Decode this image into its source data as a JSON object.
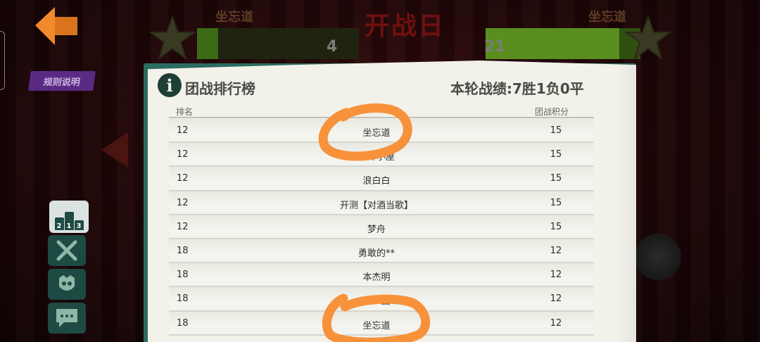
{
  "header": {
    "title": "开战日",
    "left_team": "坐忘道",
    "right_team": "坐忘道",
    "left_score": "4",
    "right_score": "21"
  },
  "rules_button": {
    "label": "规则说明"
  },
  "side_menu": {
    "icons": [
      "leaderboard-icon",
      "crossed-swords-icon",
      "guild-emblem-icon",
      "chat-icon"
    ],
    "podium": [
      "2",
      "1",
      "3"
    ]
  },
  "board": {
    "title": "团战排行榜",
    "record": "本轮战绩:7胜1负0平",
    "columns": {
      "rank": "排名",
      "score": "团战积分"
    },
    "rows": [
      {
        "rank": "12",
        "name": "坐忘道",
        "score": "15"
      },
      {
        "rank": "12",
        "name": "酒肆小屋",
        "score": "15"
      },
      {
        "rank": "12",
        "name": "浪白白",
        "score": "15"
      },
      {
        "rank": "12",
        "name": "开测【对酒当歌】",
        "score": "15"
      },
      {
        "rank": "12",
        "name": "梦舟",
        "score": "15"
      },
      {
        "rank": "18",
        "name": "勇敢的**",
        "score": "12"
      },
      {
        "rank": "18",
        "name": "本杰明",
        "score": "12"
      },
      {
        "rank": "18",
        "name": "Buff团",
        "score": "12"
      },
      {
        "rank": "18",
        "name": "坐忘道",
        "score": "12"
      }
    ]
  },
  "colors": {
    "paper": "#f2f1ea",
    "panel_teal": "#2a6b60",
    "orange_marker": "#f7923a",
    "purple_badge": "#5b2a83",
    "title_red": "#6f1010"
  }
}
